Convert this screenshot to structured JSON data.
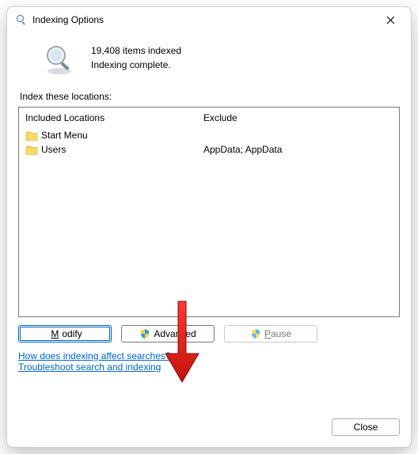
{
  "title": "Indexing Options",
  "status": {
    "items_line": "19,408 items indexed",
    "state_line": "Indexing complete."
  },
  "section_label": "Index these locations:",
  "columns": {
    "included": "Included Locations",
    "exclude": "Exclude"
  },
  "locations": [
    {
      "name": "Start Menu",
      "exclude": ""
    },
    {
      "name": "Users",
      "exclude": "AppData; AppData"
    }
  ],
  "buttons": {
    "modify_pre": "",
    "modify_accel": "M",
    "modify_post": "odify",
    "advanced": "Advanced",
    "pause_accel": "P",
    "pause_post": "ause"
  },
  "links": {
    "how": "How does indexing affect searches?",
    "troubleshoot": "Troubleshoot search and indexing"
  },
  "footer": {
    "close": "Close"
  }
}
